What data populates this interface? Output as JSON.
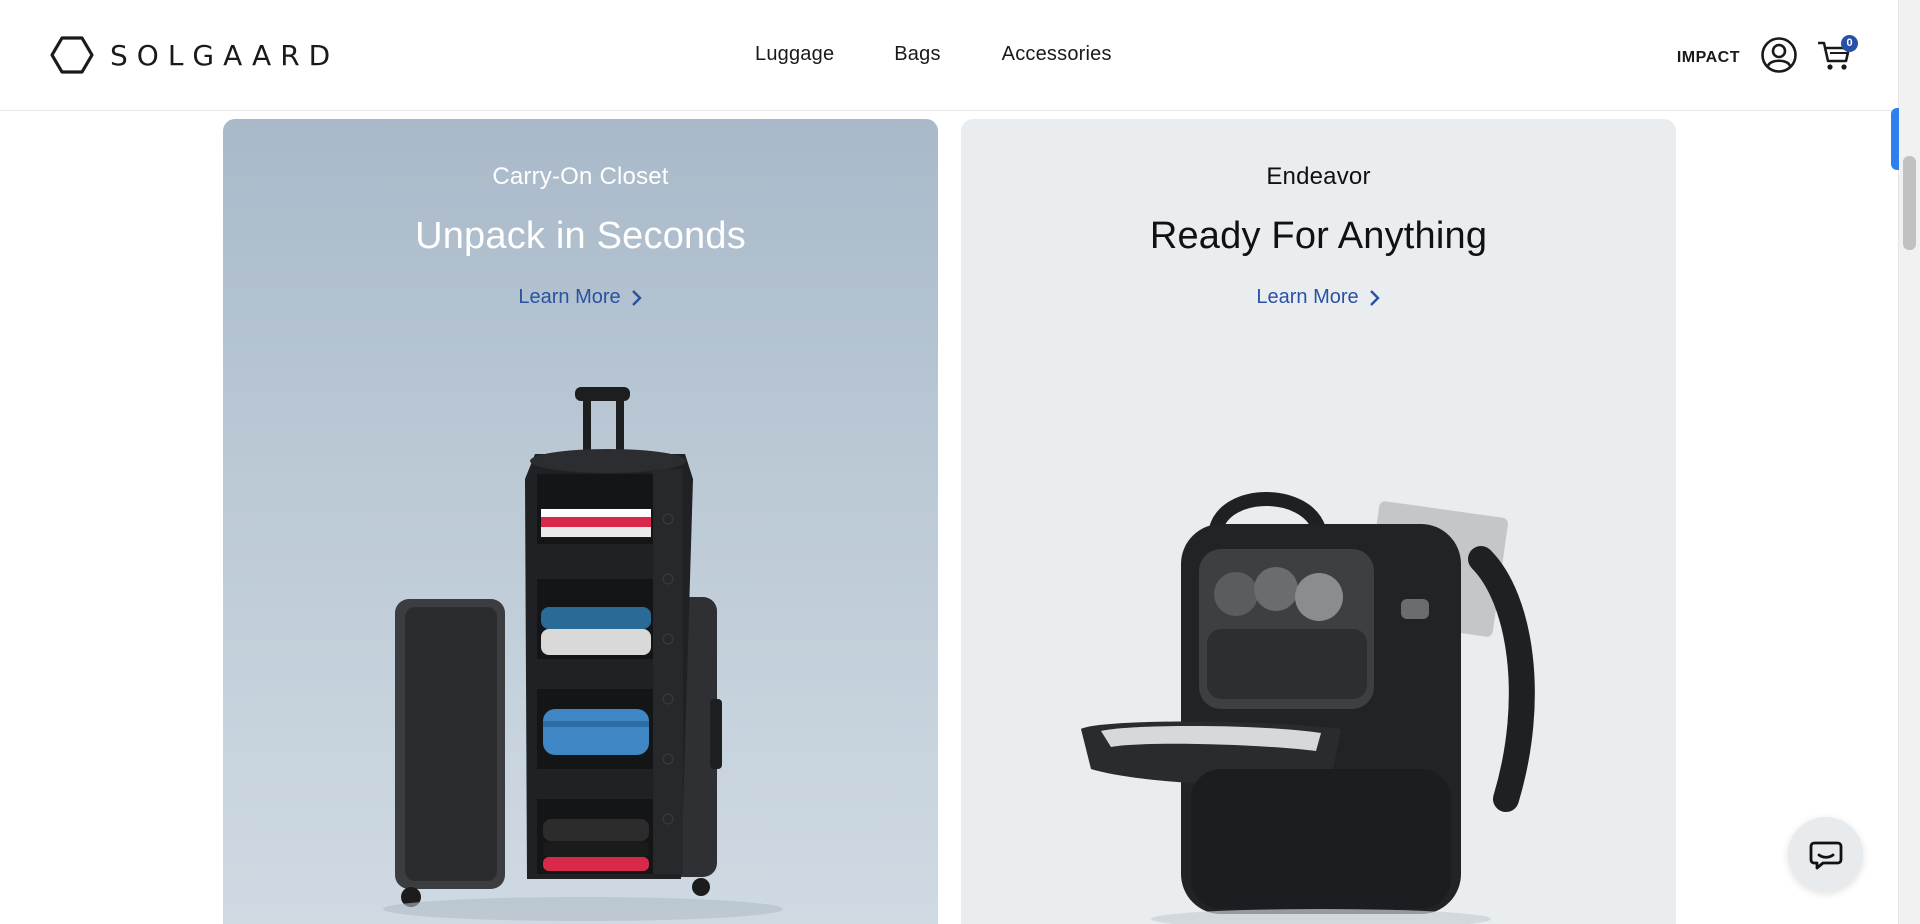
{
  "brand": {
    "name": "SOLGAARD"
  },
  "nav": {
    "items": [
      "Luggage",
      "Bags",
      "Accessories"
    ]
  },
  "header_tools": {
    "impact": "IMPACT",
    "cart_count": "0"
  },
  "cards": [
    {
      "kicker": "Carry-On Closet",
      "title": "Unpack in Seconds",
      "link": "Learn More"
    },
    {
      "kicker": "Endeavor",
      "title": "Ready For Anything",
      "link": "Learn More"
    }
  ],
  "icons": [
    "hexagon-logo-icon",
    "account-icon",
    "cart-icon",
    "chevron-right-icon",
    "chat-icon"
  ],
  "colors": {
    "accent": "#2a52a3",
    "badge": "#2751a6",
    "card_left_bg": "#bccad6",
    "card_right_bg": "#e9edf0"
  }
}
